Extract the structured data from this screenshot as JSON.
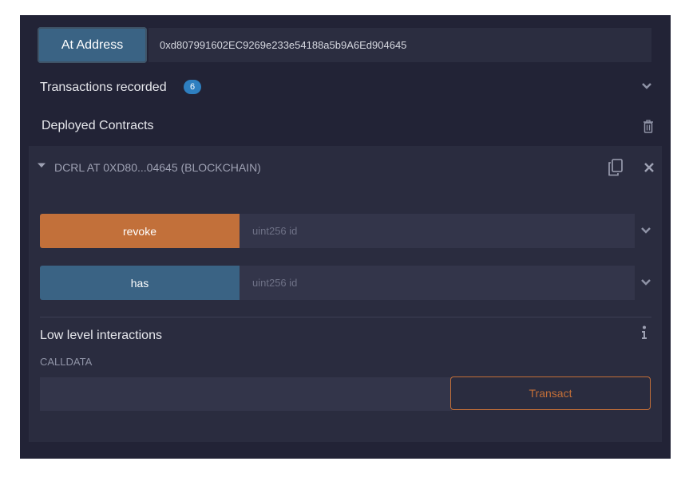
{
  "at_address": {
    "button_label": "At Address",
    "address_value": "0xd807991602EC9269e233e54188a5b9A6Ed904645"
  },
  "transactions": {
    "label": "Transactions recorded",
    "count": "6"
  },
  "deployed": {
    "label": "Deployed Contracts"
  },
  "contract": {
    "title": "DCRL AT 0XD80...04645 (BLOCKCHAIN)",
    "functions": [
      {
        "label": "revoke",
        "placeholder": "uint256 id",
        "color": "#c2703a"
      },
      {
        "label": "has",
        "placeholder": "uint256 id",
        "color": "#3a6384"
      }
    ]
  },
  "low_level": {
    "title": "Low level interactions",
    "calldata_label": "CALLDATA",
    "transact_label": "Transact"
  },
  "colors": {
    "panel_bg": "#222336",
    "accent_blue": "#3a6384",
    "accent_orange": "#c2703a",
    "badge": "#2e7fc0"
  },
  "icons": [
    "chevron-down-icon",
    "trash-icon",
    "copy-icon",
    "close-icon",
    "info-icon"
  ]
}
